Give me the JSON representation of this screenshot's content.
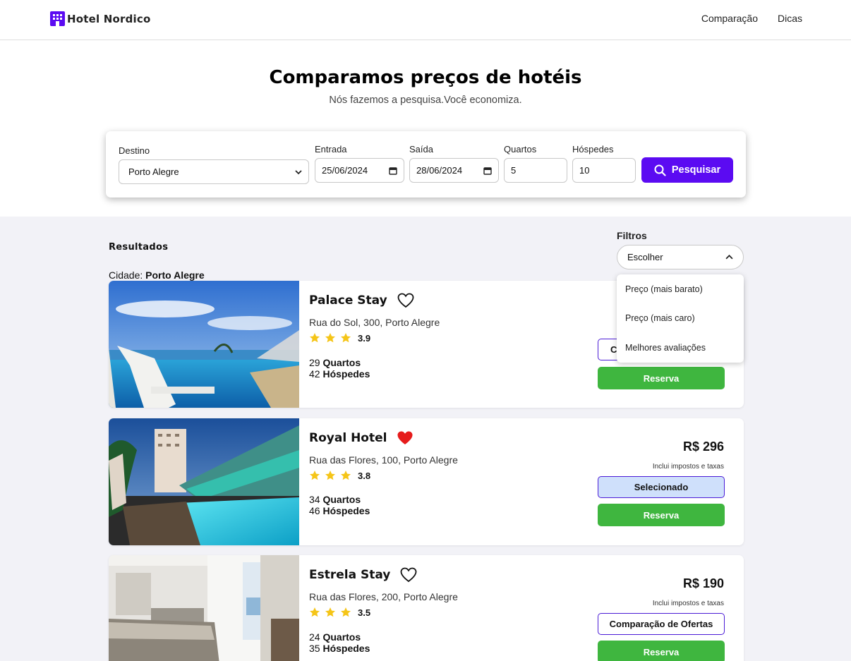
{
  "nav": {
    "brand": "Hotel Nordico",
    "links": [
      "Comparação",
      "Dicas"
    ]
  },
  "hero": {
    "title": "Comparamos preços de hotéis",
    "subtitle": "Nós fazemos a pesquisa.Você economiza."
  },
  "search": {
    "destino_label": "Destino",
    "destino_value": "Porto Alegre",
    "entrada_label": "Entrada",
    "entrada_value": "25/06/2024",
    "saida_label": "Saída",
    "saida_value": "28/06/2024",
    "quartos_label": "Quartos",
    "quartos_value": "5",
    "hospedes_label": "Hóspedes",
    "hospedes_value": "10",
    "button_label": "Pesquisar"
  },
  "results": {
    "title": "Resultados",
    "city_label": "Cidade:",
    "city_value": "Porto Alegre"
  },
  "filters": {
    "label": "Filtros",
    "selected": "Escolher",
    "options": [
      "Preço (mais barato)",
      "Preço (mais caro)",
      "Melhores avaliações"
    ]
  },
  "colors": {
    "accent": "#5b0bf2",
    "reserve": "#3fb63f",
    "star": "#f5c518",
    "heart_active": "#e61b1b"
  },
  "hotels": [
    {
      "name": "Palace Stay",
      "favorite": false,
      "address": "Rua do Sol, 300, Porto Alegre",
      "stars": 3,
      "rating": "3.9",
      "rooms_num": "29",
      "rooms_label": "Quartos",
      "guests_num": "42",
      "guests_label": "Hóspedes",
      "price": "",
      "tax_note": "",
      "compare_label": "C",
      "compare_selected": false,
      "reserve_label": "Reserva"
    },
    {
      "name": "Royal Hotel",
      "favorite": true,
      "address": "Rua das Flores, 100, Porto Alegre",
      "stars": 3,
      "rating": "3.8",
      "rooms_num": "34",
      "rooms_label": "Quartos",
      "guests_num": "46",
      "guests_label": "Hóspedes",
      "price": "R$ 296",
      "tax_note": "Inclui impostos e taxas",
      "compare_label": "Selecionado",
      "compare_selected": true,
      "reserve_label": "Reserva"
    },
    {
      "name": "Estrela Stay",
      "favorite": false,
      "address": "Rua das Flores, 200, Porto Alegre",
      "stars": 3,
      "rating": "3.5",
      "rooms_num": "24",
      "rooms_label": "Quartos",
      "guests_num": "35",
      "guests_label": "Hóspedes",
      "price": "R$ 190",
      "tax_note": "Inclui impostos e taxas",
      "compare_label": "Comparação de Ofertas",
      "compare_selected": false,
      "reserve_label": "Reserva"
    }
  ]
}
